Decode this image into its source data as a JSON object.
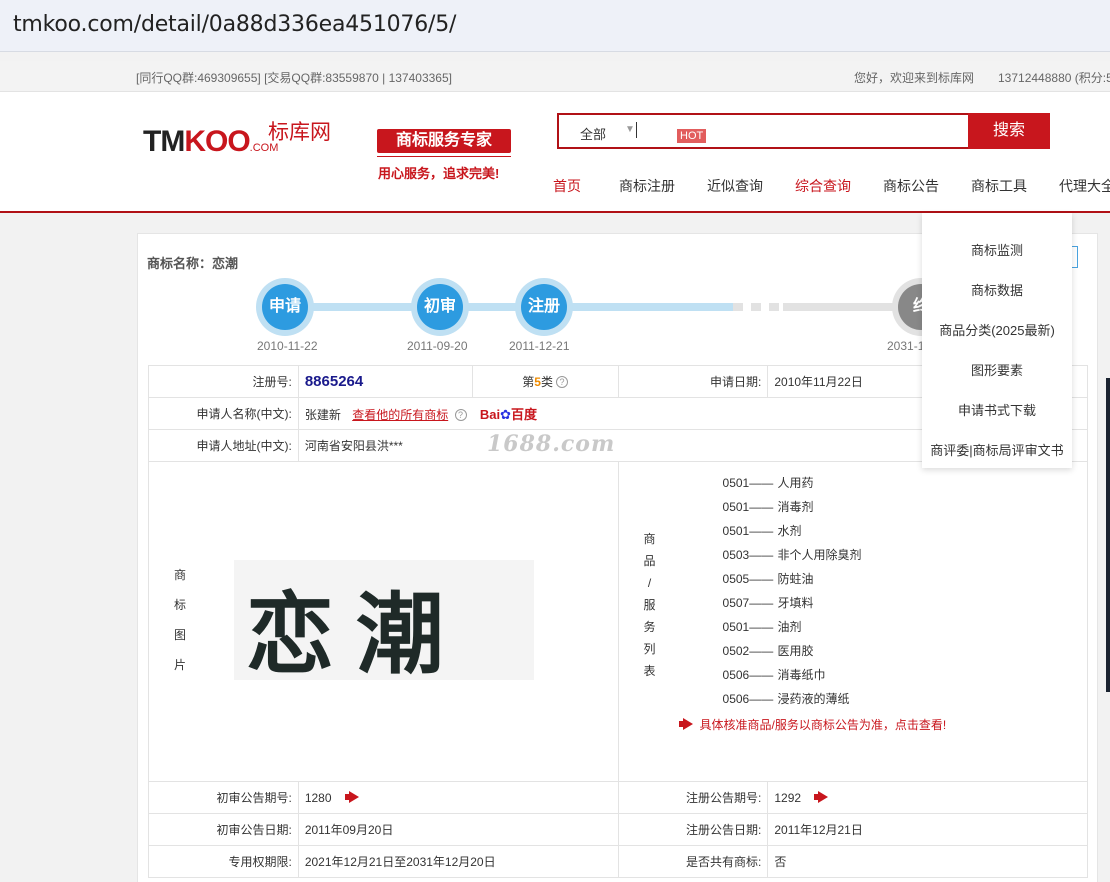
{
  "browser": {
    "url": "tmkoo.com/detail/0a88d336ea451076/5/"
  },
  "topbar": {
    "qq": "[同行QQ群:469309655] [交易QQ群:83559870 | 137403365]",
    "welcome": "您好，欢迎来到标库网",
    "user": "13712448880 (积分:5"
  },
  "header": {
    "logo_tm": "TM",
    "logo_koo": "KOO",
    "logo_com": ".COM",
    "logo_cn": "标库网",
    "expert": "商标服务专家",
    "slogan": "用心服务，追求完美!"
  },
  "search": {
    "scope": "全部",
    "caret": "▼",
    "hot": "HOT",
    "button": "搜索"
  },
  "nav": [
    "首页",
    "商标注册",
    "近似查询",
    "综合查询",
    "商标公告",
    "商标工具",
    "代理大全"
  ],
  "dropdown": [
    "商标监测",
    "商标数据",
    "商品分类(2025最新)",
    "图形要素",
    "申请书式下载",
    "商评委|商标局评审文书"
  ],
  "trademark": {
    "name_label": "商标名称：",
    "name": "恋潮",
    "timeline": [
      {
        "label": "申请",
        "date": "2010-11-22"
      },
      {
        "label": "初审",
        "date": "2011-09-20"
      },
      {
        "label": "注册",
        "date": "2011-12-21"
      },
      {
        "label": "终",
        "date": "2031-1"
      }
    ],
    "reg_no_label": "注册号:",
    "reg_no": "8865264",
    "class_prefix": "第",
    "class_no": "5",
    "class_suffix": "类",
    "help": "?",
    "apply_date_label": "申请日期:",
    "apply_date": "2010年11月22日",
    "applicant_label": "申请人名称(中文):",
    "applicant": "张建新",
    "all_tm_link": "查看他的所有商标",
    "baidu_a": "Bai",
    "baidu_b": "百度",
    "address_label": "申请人地址(中文):",
    "address": "河南省安阳县洪***",
    "watermark": "1688.com",
    "image_label": [
      "商",
      "标",
      "图",
      "片"
    ],
    "image_text": "恋潮",
    "goods_label": [
      "商",
      "品",
      "/",
      "服",
      "务",
      "列",
      "表"
    ],
    "goods": [
      {
        "code": "0501——",
        "name": "人用药"
      },
      {
        "code": "0501——",
        "name": "消毒剂"
      },
      {
        "code": "0501——",
        "name": "水剂"
      },
      {
        "code": "0503——",
        "name": "非个人用除臭剂"
      },
      {
        "code": "0505——",
        "name": "防蛀油"
      },
      {
        "code": "0507——",
        "name": "牙填料"
      },
      {
        "code": "0501——",
        "name": "油剂"
      },
      {
        "code": "0502——",
        "name": "医用胶"
      },
      {
        "code": "0506——",
        "name": "消毒纸巾"
      },
      {
        "code": "0506——",
        "name": "浸药液的薄纸"
      }
    ],
    "goods_note": "具体核准商品/服务以商标公告为准，点击查看!",
    "prelim_no_label": "初审公告期号:",
    "prelim_no": "1280",
    "reg_ann_no_label": "注册公告期号:",
    "reg_ann_no": "1292",
    "prelim_date_label": "初审公告日期:",
    "prelim_date": "2011年09月20日",
    "reg_ann_date_label": "注册公告日期:",
    "reg_ann_date": "2011年12月21日",
    "validity_label": "专用权期限:",
    "validity": "2021年12月21日至2031年12月20日",
    "shared_label": "是否共有商标:",
    "shared": "否"
  },
  "colors": {
    "brand_red": "#c8161d",
    "timeline_blue": "#2d9be0",
    "timeline_light": "#bfe0f3"
  }
}
